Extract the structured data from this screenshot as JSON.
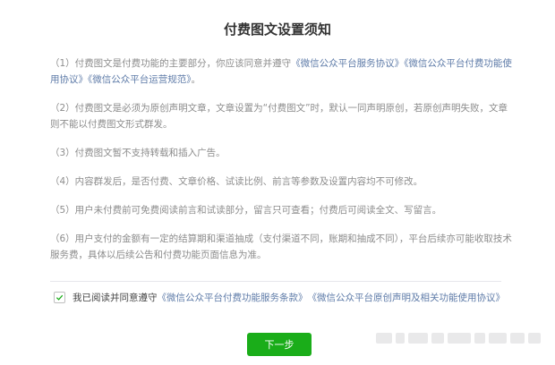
{
  "dialog": {
    "title": "付费图文设置须知",
    "rules": [
      {
        "prefix": "（1）付费图文是付费功能的主要部分，你应该同意并遵守",
        "link1": "《微信公众平台服务协议》",
        "link2": "《微信公众平台付费功能使用协议》",
        "link3": "《微信公众平台运营规范》",
        "suffix": "。"
      },
      {
        "text": "（2）付费图文是必须为原创声明文章，文章设置为“付费图文”时，默认一同声明原创，若原创声明失败，文章则不能以付费图文形式群发。"
      },
      {
        "text": "（3）付费图文暂不支持转载和插入广告。"
      },
      {
        "text": "（4）内容群发后，是否付费、文章价格、试读比例、前言等参数及设置内容均不可修改。"
      },
      {
        "text": "（5）用户未付费前可免费阅读前言和试读部分，留言只可查看；付费后可阅读全文、写留言。"
      },
      {
        "text": "（6）用户支付的金额有一定的结算期和渠道抽成（支付渠道不同，账期和抽成不同），平台后续亦可能收取技术服务费，具体以后续公告和付费功能页面信息为准。"
      }
    ],
    "agreement": {
      "checked": true,
      "prefix": "我已阅读并同意遵守",
      "link1": "《微信公众平台付费功能服务条款》",
      "link2": "《微信公众平台原创声明及相关功能使用协议》"
    },
    "next_button": "下一步"
  },
  "colors": {
    "accent_green": "#1aad19",
    "link_blue": "#5e7ba8",
    "body_text": "#8c8c8c",
    "title_text": "#333333"
  },
  "icons": {
    "checkbox": "checkmark-icon"
  }
}
